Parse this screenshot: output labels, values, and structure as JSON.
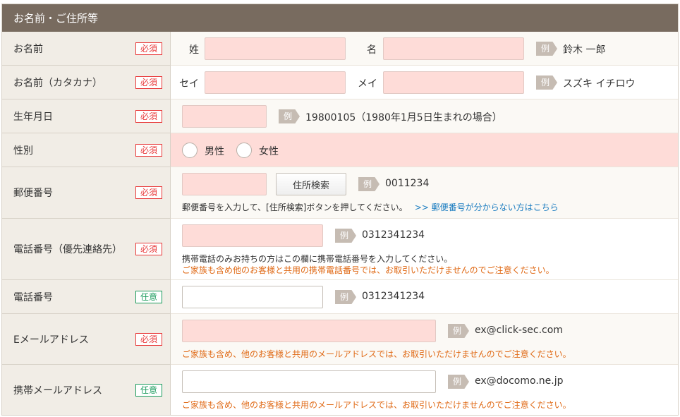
{
  "section_title": "お名前・ご住所等",
  "badges": {
    "required": "必須",
    "optional": "任意"
  },
  "example_label": "例",
  "rows": {
    "name": {
      "label": "お名前",
      "last_label": "姓",
      "first_label": "名",
      "example": "鈴木 一郎"
    },
    "kana": {
      "label": "お名前（カタカナ）",
      "last_label": "セイ",
      "first_label": "メイ",
      "example": "スズキ イチロウ"
    },
    "birthday": {
      "label": "生年月日",
      "example": "19800105（1980年1月5日生まれの場合）"
    },
    "gender": {
      "label": "性別",
      "options": [
        "男性",
        "女性"
      ]
    },
    "postal": {
      "label": "郵便番号",
      "search_button": "住所検索",
      "example": "0011234",
      "note": "郵便番号を入力して、[住所検索]ボタンを押してください。",
      "link": ">> 郵便番号が分からない方はこちら"
    },
    "phone_primary": {
      "label": "電話番号（優先連絡先）",
      "example": "0312341234",
      "note": "携帯電話のみお持ちの方はこの欄に携帯電話番号を入力してください。",
      "warning": "ご家族も含め他のお客様と共用の携帯電話番号では、お取引いただけませんのでご注意ください。"
    },
    "phone": {
      "label": "電話番号",
      "example": "0312341234"
    },
    "email": {
      "label": "Eメールアドレス",
      "example": "ex@click-sec.com",
      "warning": "ご家族も含め、他のお客様と共用のメールアドレスでは、お取引いただけませんのでご注意ください。"
    },
    "mobile_email": {
      "label": "携帯メールアドレス",
      "example": "ex@docomo.ne.jp",
      "warning": "ご家族も含め、他のお客様と共用のメールアドレスでは、お取引いただけませんのでご注意ください。"
    }
  },
  "colors": {
    "header_bg": "#786b5f",
    "label_bg": "#f1ede6",
    "input_pink": "#fedcd8",
    "required_red": "#e8393a",
    "optional_green": "#1a9b5c",
    "warning_orange": "#e06a16",
    "link_blue": "#1a7cc0"
  }
}
